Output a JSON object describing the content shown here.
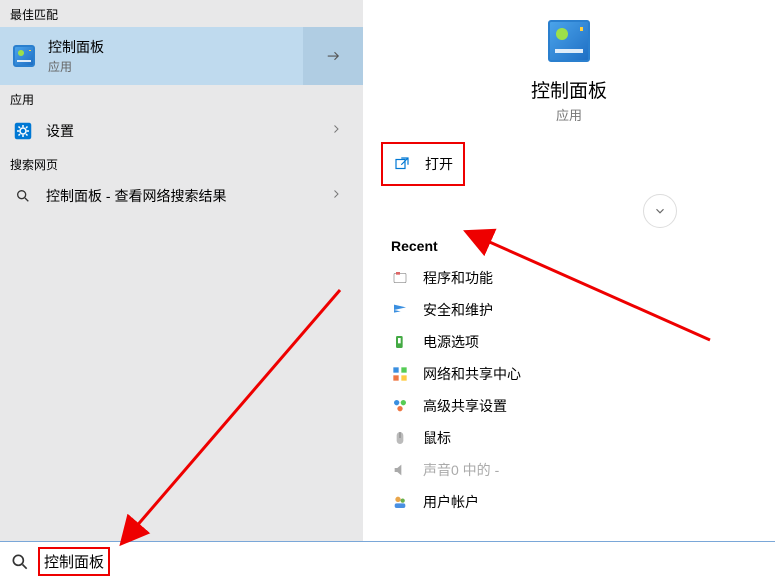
{
  "left": {
    "bestMatchHeader": "最佳匹配",
    "topResult": {
      "title": "控制面板",
      "subtitle": "应用"
    },
    "appsHeader": "应用",
    "settingsLabel": "设置",
    "webHeader": "搜索网页",
    "webRow": {
      "label": "控制面板",
      "suffix": " - 查看网络搜索结果"
    }
  },
  "preview": {
    "title": "控制面板",
    "subtitle": "应用",
    "openLabel": "打开",
    "recentHeader": "Recent",
    "recent": [
      {
        "label": "程序和功能"
      },
      {
        "label": "安全和维护"
      },
      {
        "label": "电源选项"
      },
      {
        "label": "网络和共享中心"
      },
      {
        "label": "高级共享设置"
      },
      {
        "label": "鼠标"
      },
      {
        "label": "声音0 中的 -",
        "disabled": true
      },
      {
        "label": "用户帐户"
      }
    ]
  },
  "search": {
    "value": "控制面板"
  }
}
